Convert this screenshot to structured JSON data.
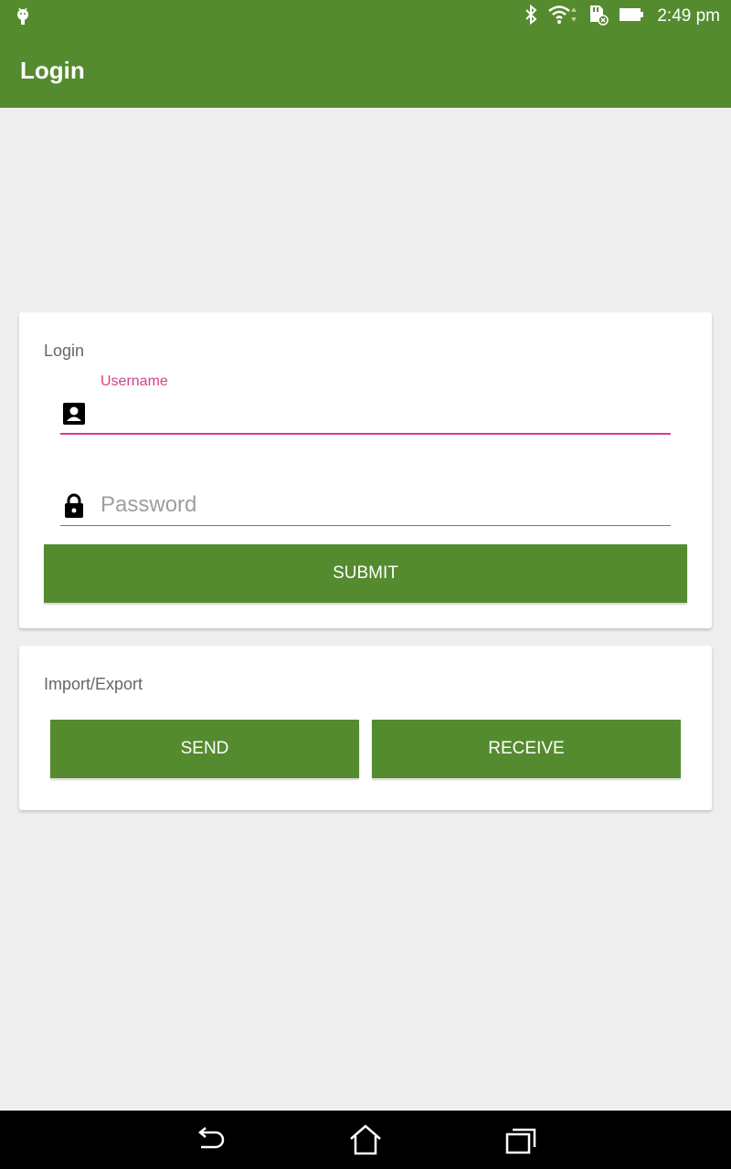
{
  "status_bar": {
    "time": "2:49 pm",
    "icons": [
      "android-debug-icon",
      "bluetooth-icon",
      "wifi-icon",
      "sd-card-icon",
      "battery-icon"
    ]
  },
  "app_bar": {
    "title": "Login"
  },
  "login_card": {
    "title": "Login",
    "username": {
      "label": "Username",
      "value": "",
      "icon": "account-box-icon"
    },
    "password": {
      "placeholder": "Password",
      "value": "",
      "icon": "lock-icon"
    },
    "submit_label": "SUBMIT"
  },
  "io_card": {
    "title": "Import/Export",
    "send_label": "SEND",
    "receive_label": "RECEIVE"
  },
  "nav_bar": {
    "icons": [
      "back-icon",
      "home-icon",
      "recent-apps-icon"
    ]
  },
  "colors": {
    "primary": "#558b2f",
    "accent": "#d63f86",
    "background": "#eeeeee"
  }
}
